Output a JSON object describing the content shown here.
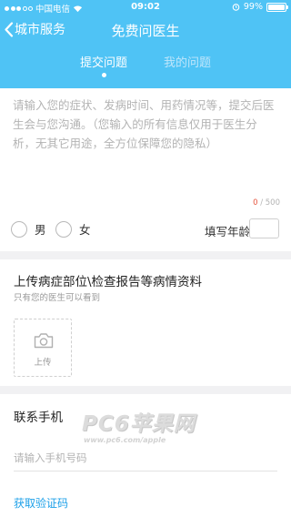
{
  "status_bar": {
    "carrier": "中国电信",
    "time": "09:02",
    "battery": "99%",
    "battery_level": 0.99,
    "signal_icon": "signal-dots-icon",
    "wifi_icon": "wifi-icon",
    "alarm_icon": "alarm-icon"
  },
  "nav": {
    "back_label": "城市服务",
    "title": "免费问医生",
    "back_icon": "chevron-left-icon"
  },
  "tabs": [
    {
      "label": "提交问题",
      "active": true
    },
    {
      "label": "我的问题",
      "active": false
    }
  ],
  "question": {
    "placeholder": "请输入您的症状、发病时间、用药情况等，提交后医生会与您沟通。（您输入的所有信息仅用于医生分析，无其它用途，全方位保障您的隐私）",
    "count": "0",
    "max": " / 500"
  },
  "gender": {
    "male": "男",
    "female": "女"
  },
  "age": {
    "label": "填写年龄:",
    "value": ""
  },
  "upload": {
    "title": "上传病症部位\\检查报告等病情资料",
    "subtitle": "只有您的医生可以看到",
    "button_label": "上传",
    "icon": "camera-icon"
  },
  "contact": {
    "title": "联系手机",
    "phone_placeholder": "请输入手机号码",
    "get_code": "获取验证码"
  },
  "watermark": {
    "main": "PC6苹果网",
    "url": "www.pc6.com/apple"
  },
  "colors": {
    "accent": "#4fc3f5",
    "link": "#1da0e8",
    "counter": "#e5533c",
    "placeholder": "#b3b3b3"
  }
}
